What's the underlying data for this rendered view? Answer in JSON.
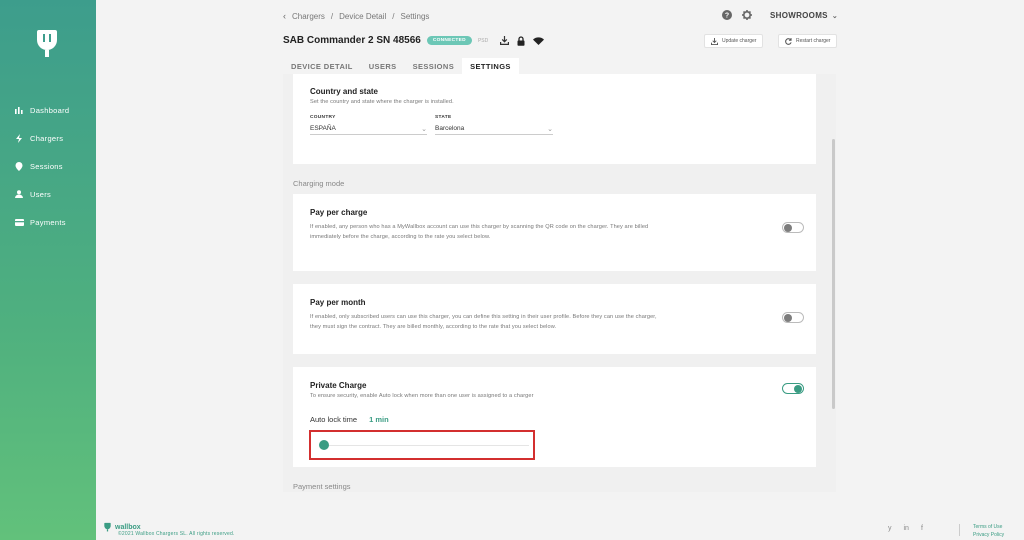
{
  "sidebar": {
    "items": [
      {
        "label": "Dashboard",
        "icon": "bar-chart-icon"
      },
      {
        "label": "Chargers",
        "icon": "bolt-icon"
      },
      {
        "label": "Sessions",
        "icon": "location-pin-icon"
      },
      {
        "label": "Users",
        "icon": "user-icon"
      },
      {
        "label": "Payments",
        "icon": "credit-card-icon"
      }
    ]
  },
  "breadcrumb": {
    "items": [
      "Chargers",
      "Device Detail",
      "Settings"
    ]
  },
  "header": {
    "account": "SHOWROOMS",
    "charger_name": "SAB Commander 2 SN 48566",
    "status": "CONNECTED",
    "tag": "PSD",
    "update_label": "Update charger",
    "restart_label": "Restart charger"
  },
  "tabs": [
    {
      "label": "DEVICE DETAIL",
      "active": false
    },
    {
      "label": "USERS",
      "active": false
    },
    {
      "label": "SESSIONS",
      "active": false
    },
    {
      "label": "SETTINGS",
      "active": true
    }
  ],
  "country_state": {
    "title": "Country and state",
    "desc": "Set the country and state where the charger is installed.",
    "country_label": "COUNTRY",
    "country_value": "ESPAÑA",
    "state_label": "STATE",
    "state_value": "Barcelona"
  },
  "charging_mode": {
    "section": "Charging mode",
    "pay_per_charge": {
      "title": "Pay per charge",
      "desc": "If enabled, any person who has a MyWallbox account can use this charger by scanning the QR code on the charger. They are billed immediately before the charge, according to the rate you select below.",
      "enabled": false
    },
    "pay_per_month": {
      "title": "Pay per month",
      "desc": "If enabled, only subscribed users can use this charger, you can define this setting in their user profile. Before they can use the charger, they must sign the contract. They are billed monthly, according to the rate that you select below.",
      "enabled": false
    },
    "private_charge": {
      "title": "Private Charge",
      "desc": "To ensure security, enable Auto lock when more than one user is assigned to a charger",
      "enabled": true,
      "auto_lock_label": "Auto lock time",
      "auto_lock_value": "1 min",
      "slider_level": 0.0
    }
  },
  "payment_settings": {
    "section": "Payment settings"
  },
  "footer": {
    "brand": "wallbox",
    "copyright": "©2021 Wallbox Chargers SL. All rights reserved.",
    "terms": "Terms of Use",
    "privacy": "Privacy Policy",
    "social": [
      "y",
      "in",
      "f"
    ]
  },
  "colors": {
    "accent": "#3a9c83",
    "badge": "#6cc7b6",
    "highlight": "#d32f2f"
  }
}
